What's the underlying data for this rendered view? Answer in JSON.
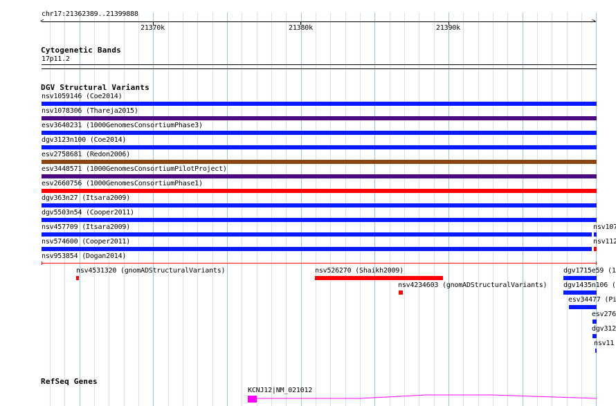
{
  "ruler": {
    "locus": "chr17:21362389..21399888",
    "ticks": [
      "21370k",
      "21380k",
      "21390k"
    ]
  },
  "cytobands": {
    "title": "Cytogenetic Bands",
    "band": "17p11.2"
  },
  "dgv": {
    "title": "DGV Structural Variants",
    "full_rows": [
      {
        "label": "nsv1059146 (Coe2014)",
        "color": "#0a1aff"
      },
      {
        "label": "nsv1078306 (Thareja2015)",
        "color": "#4b0b80"
      },
      {
        "label": "esv3640231 (1000GenomesConsortiumPhase3)",
        "color": "#0a1aff"
      },
      {
        "label": "dgv3123n100 (Coe2014)",
        "color": "#0a1aff"
      },
      {
        "label": "esv2758681 (Redon2006)",
        "color": "#8b4513"
      },
      {
        "label": "esv3448571 (1000GenomesConsortiumPilotProject)",
        "color": "#4b0b80"
      },
      {
        "label": "esv2660756 (1000GenomesConsortiumPhase1)",
        "color": "#ff0000"
      },
      {
        "label": "dgv363n27 (Itsara2009)",
        "color": "#0a1aff"
      },
      {
        "label": "dgv5503n54 (Cooper2011)",
        "color": "#0a1aff"
      },
      {
        "label": "nsv457709 (Itsara2009)",
        "color": "#0a1aff"
      },
      {
        "label": "nsv574600 (Cooper2011)",
        "color": "#0a1aff"
      },
      {
        "label": "nsv953854 (Dogan2014)",
        "color": "#ff0000"
      }
    ],
    "right_edge_labels": [
      "nsv107",
      "nsv112"
    ],
    "small_features": [
      {
        "label": "nsv4531320 (gnomADStructuralVariants)",
        "color": "#ff0000"
      },
      {
        "label": "nsv526270 (Shaikh2009)",
        "color": "#ff0000"
      },
      {
        "label": "nsv4234603 (gnomADStructuralVariants)",
        "color": "#ff0000"
      },
      {
        "label": "dgv1715e59 (1",
        "color": "#0a1aff"
      },
      {
        "label": "dgv1435n106 (",
        "color": "#0a1aff"
      },
      {
        "label": "esv34477 (Pi",
        "color": "#0a1aff"
      },
      {
        "label": "esv276",
        "color": "#0a1aff"
      },
      {
        "label": "dgv312",
        "color": "#0a1aff"
      },
      {
        "label": "nsv11",
        "color": "#0a1aff"
      }
    ]
  },
  "refseq": {
    "title": "RefSeq Genes",
    "gene_label": "KCNJ12|NM_021012",
    "color": "#ff00ff"
  }
}
